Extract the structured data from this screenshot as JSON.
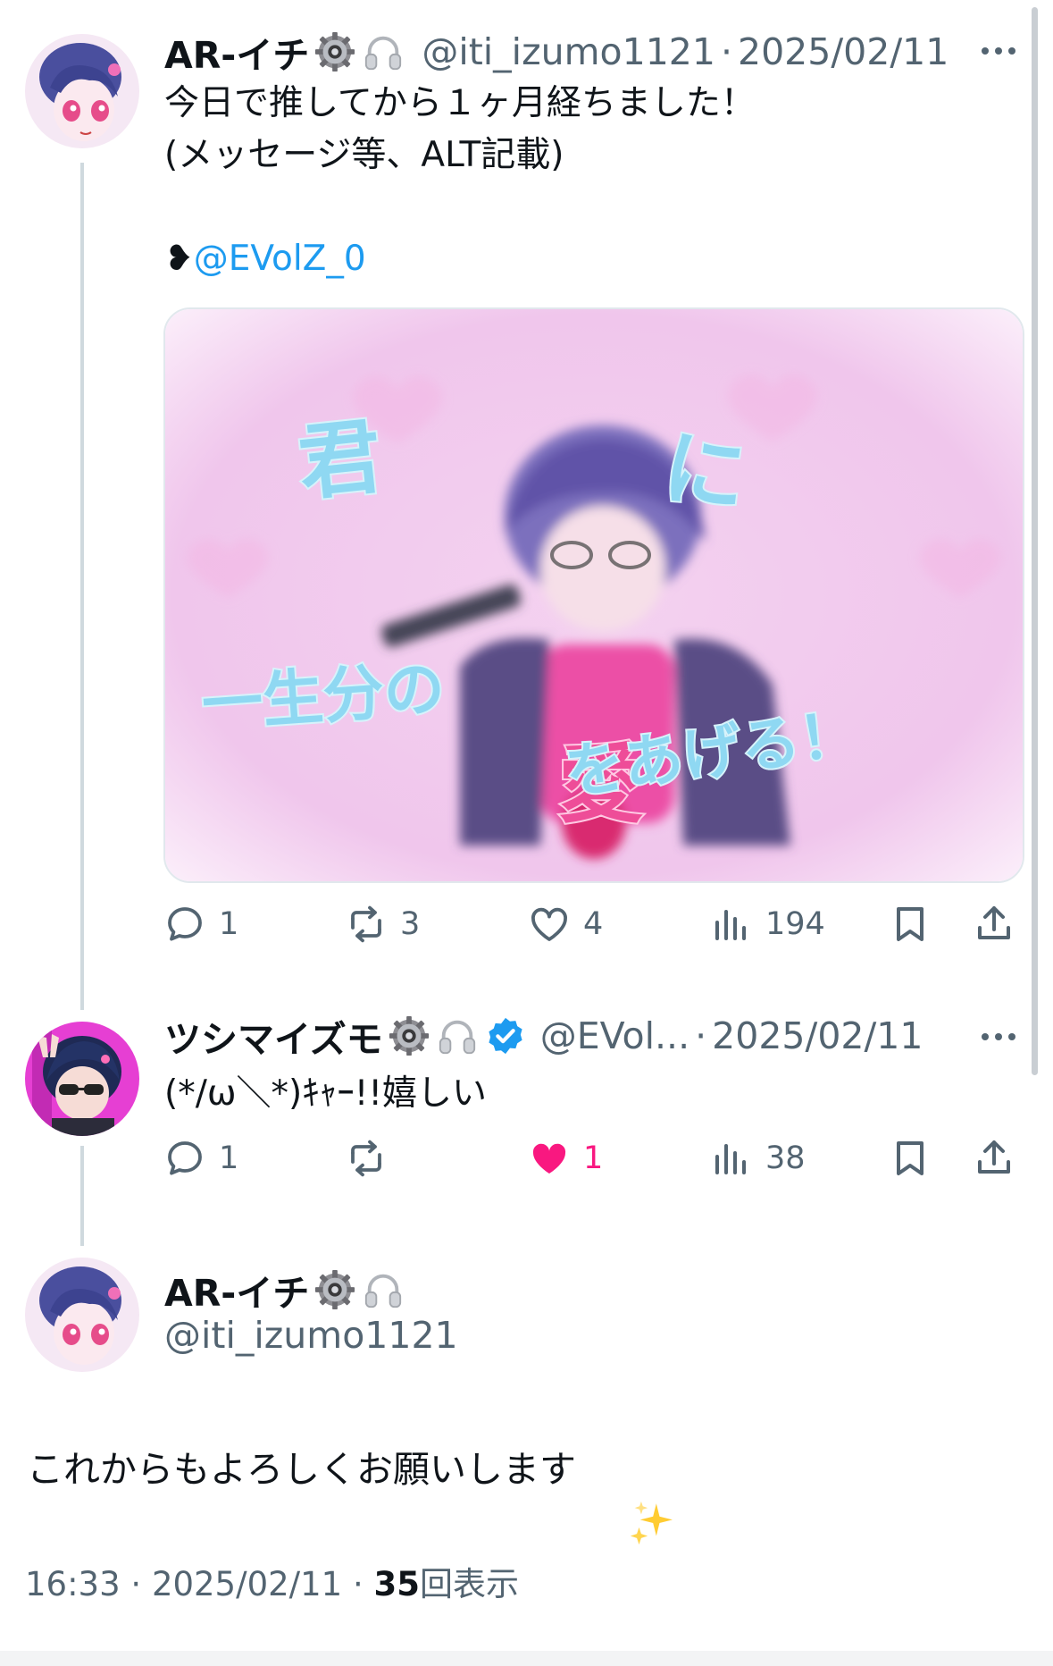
{
  "tweets": [
    {
      "name": "AR-イチ",
      "handle": "@iti_izumo1121",
      "dot": "·",
      "date": "2025/02/11",
      "text_line1": "今日で推してから１ヶ月経ちました！",
      "text_line2": "(メッセージ等、ALT記載)",
      "mention_prefix": "❥",
      "mention": "@EVolZ_0",
      "media_text": {
        "a": "君",
        "b": "に",
        "c": "一生分の",
        "d": "愛",
        "e": "をあげる！"
      },
      "actions": {
        "reply": "1",
        "retweet": "3",
        "like": "4",
        "views": "194"
      }
    },
    {
      "name": "ツシマイズモ",
      "handle": "@EVol...",
      "dot": "·",
      "date": "2025/02/11",
      "text": "(*/ω＼*)ｷｬｰ!!嬉しい",
      "actions": {
        "reply": "1",
        "retweet": "",
        "like": "1",
        "views": "38"
      }
    }
  ],
  "main_tweet": {
    "name": "AR-イチ",
    "handle": "@iti_izumo1121",
    "text": "これからもよろしくお願いします",
    "time": "16:33",
    "dot": "·",
    "date": "2025/02/11",
    "views_count": "35",
    "views_label": "回表示"
  },
  "icons": [
    "gear-emoji",
    "headphones-emoji",
    "verified-badge-icon",
    "more-icon",
    "reply-icon",
    "retweet-icon",
    "like-icon",
    "views-icon",
    "bookmark-icon",
    "share-icon",
    "sparkles-emoji"
  ],
  "colors": {
    "accent": "#1d9bf0",
    "like": "#f91880",
    "muted": "#536471",
    "thread": "#cfd9de"
  }
}
